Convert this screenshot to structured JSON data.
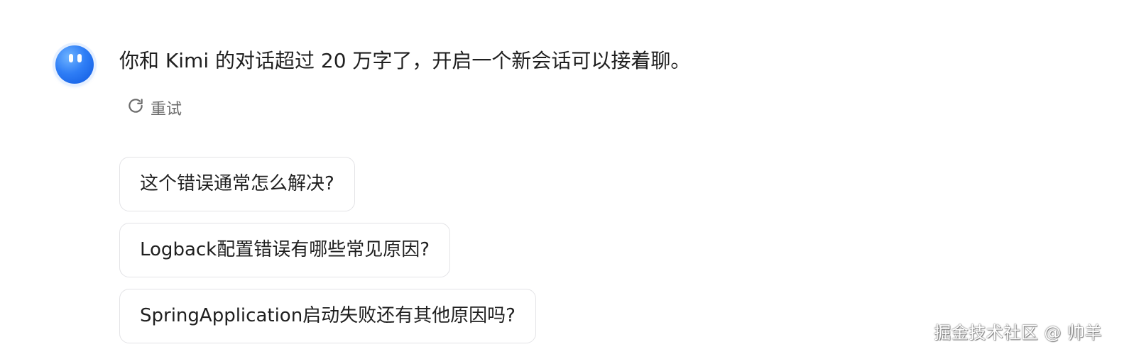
{
  "assistant": {
    "avatar_icon": "kimi-avatar-icon",
    "message": "你和 Kimi 的对话超过 20 万字了，开启一个新会话可以接着聊。"
  },
  "actions": {
    "retry_icon": "refresh-icon",
    "retry_label": "重试"
  },
  "suggestions": [
    "这个错误通常怎么解决?",
    "Logback配置错误有哪些常见原因?",
    "SpringApplication启动失败还有其他原因吗?"
  ],
  "watermark": "掘金技术社区 @ 帅羊",
  "colors": {
    "avatar": "#2f7ef6",
    "text": "#1f1f1f",
    "muted": "#6b6b6b",
    "border": "#e3e3e6"
  }
}
